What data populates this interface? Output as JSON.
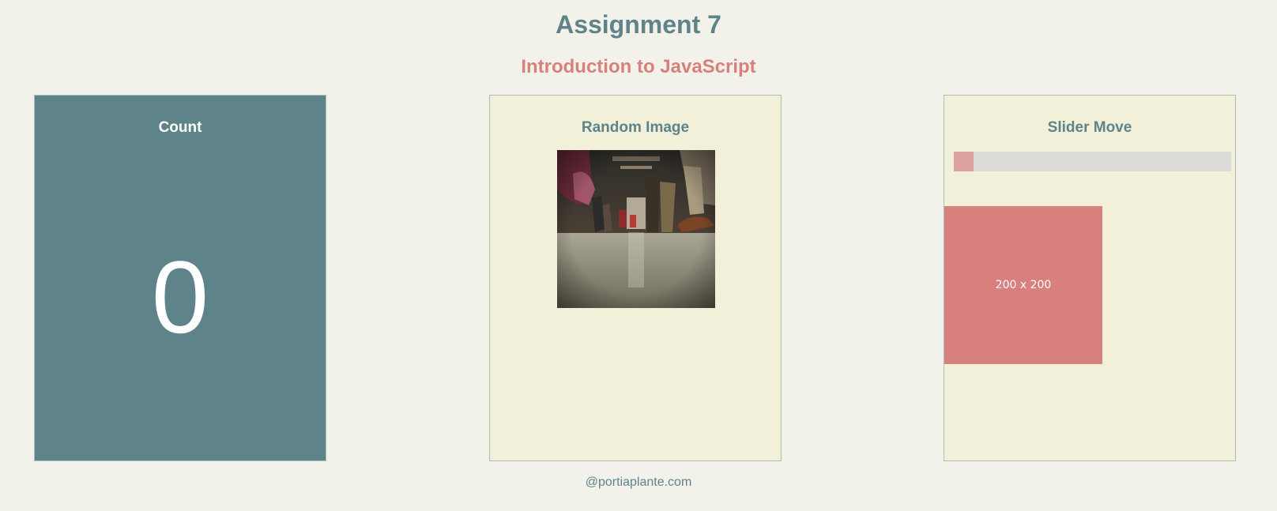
{
  "header": {
    "title": "Assignment 7",
    "subtitle": "Introduction to JavaScript"
  },
  "panels": {
    "count": {
      "title": "Count",
      "value": "0"
    },
    "random_image": {
      "title": "Random Image",
      "image_alt": "subway car floor with passengers' feet"
    },
    "slider": {
      "title": "Slider Move",
      "slider_level": 0.07,
      "box_label": "200 x 200"
    }
  },
  "footer": {
    "text": "@portiaplante.com"
  },
  "colors": {
    "background": "#f2f2ea",
    "teal": "#5e848a",
    "coral": "#d7817d",
    "panel_cream": "#f2f0d8",
    "slider_track": "#dcdbd6",
    "slider_fill": "#dea3a0"
  }
}
